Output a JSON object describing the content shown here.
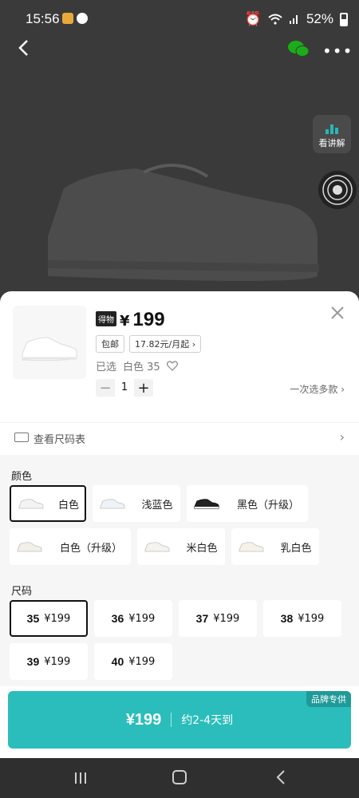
{
  "status_bar": {
    "time": "15:56",
    "battery": "52%"
  },
  "explain": {
    "label": "看讲解"
  },
  "sheet": {
    "badge": "得物",
    "currency": "¥",
    "price": "199",
    "shipping": "包邮",
    "installment": "17.82元/月起",
    "installment_chevron": "›",
    "selected_prefix": "已选",
    "selected_value": "白色 35",
    "quantity": "1",
    "multi_select": "一次选多款 ›",
    "size_chart": "查看尺码表",
    "size_chart_chevron": "›"
  },
  "color_section": {
    "title": "颜色",
    "options": [
      {
        "label": "白色",
        "selected": true
      },
      {
        "label": "浅蓝色"
      },
      {
        "label": "黑色（升级）"
      },
      {
        "label": "白色（升级）"
      },
      {
        "label": "米白色"
      },
      {
        "label": "乳白色"
      }
    ]
  },
  "size_section": {
    "title": "尺码",
    "options": [
      {
        "size": "35",
        "price": "¥199",
        "selected": true
      },
      {
        "size": "36",
        "price": "¥199"
      },
      {
        "size": "37",
        "price": "¥199"
      },
      {
        "size": "38",
        "price": "¥199"
      },
      {
        "size": "39",
        "price": "¥199"
      },
      {
        "size": "40",
        "price": "¥199"
      }
    ]
  },
  "buy": {
    "price": "¥199",
    "eta": "约2-4天到",
    "badge": "品牌专供"
  },
  "colors": {
    "accent": "#2bbdbb"
  }
}
